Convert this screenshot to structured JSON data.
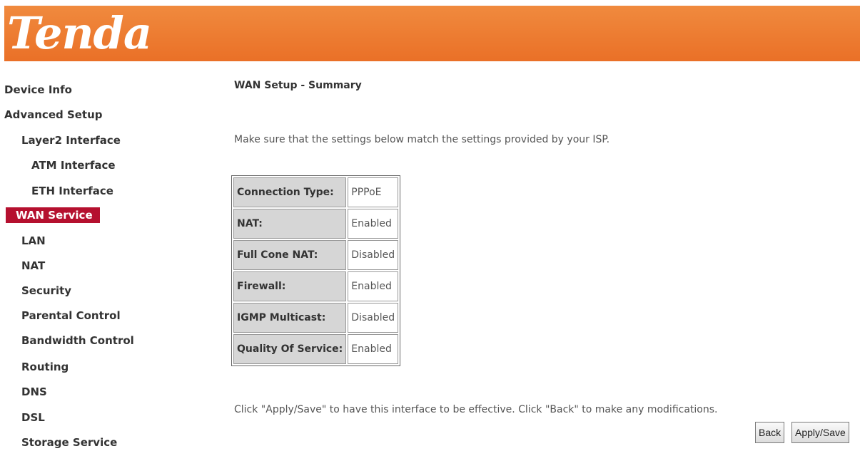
{
  "brand": {
    "logo_text": "Tenda",
    "header_color": "#ea7027"
  },
  "sidebar": {
    "items": [
      {
        "label": "Device Info",
        "active": false
      },
      {
        "label": "Advanced Setup",
        "active": false
      },
      {
        "label": "Layer2 Interface",
        "active": false
      },
      {
        "label": "ATM Interface",
        "active": false
      },
      {
        "label": "ETH Interface",
        "active": false
      },
      {
        "label": "WAN Service",
        "active": true
      },
      {
        "label": "LAN",
        "active": false
      },
      {
        "label": "NAT",
        "active": false
      },
      {
        "label": "Security",
        "active": false
      },
      {
        "label": "Parental Control",
        "active": false
      },
      {
        "label": "Bandwidth Control",
        "active": false
      },
      {
        "label": "Routing",
        "active": false
      },
      {
        "label": "DNS",
        "active": false
      },
      {
        "label": "DSL",
        "active": false
      },
      {
        "label": "Storage Service",
        "active": false
      }
    ],
    "active_color": "#b5102f"
  },
  "main": {
    "title": "WAN Setup - Summary",
    "intro": "Make sure that the settings below match the settings provided by your ISP.",
    "summary": [
      {
        "label": "Connection Type:",
        "value": "PPPoE"
      },
      {
        "label": "NAT:",
        "value": "Enabled"
      },
      {
        "label": "Full Cone NAT:",
        "value": "Disabled"
      },
      {
        "label": "Firewall:",
        "value": "Enabled"
      },
      {
        "label": "IGMP Multicast:",
        "value": "Disabled"
      },
      {
        "label": "Quality Of Service:",
        "value": "Enabled"
      }
    ],
    "note": "Click \"Apply/Save\" to have this interface to be effective. Click \"Back\" to make any modifications.",
    "buttons": {
      "back": "Back",
      "apply_save": "Apply/Save"
    }
  }
}
